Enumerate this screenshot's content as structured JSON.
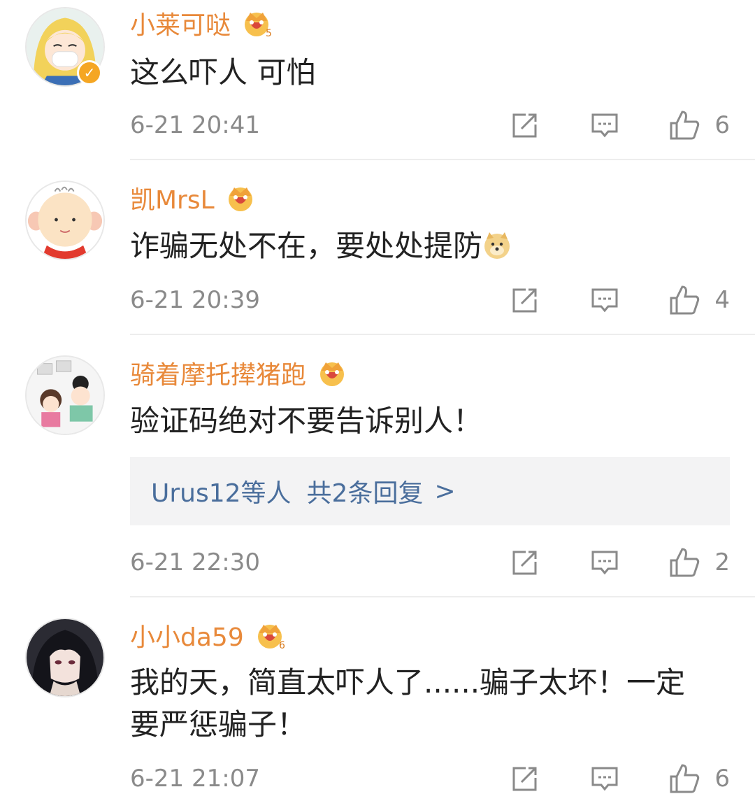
{
  "comments": [
    {
      "username": "小莱可哒",
      "verified_icon": "verified-check-icon",
      "vip_icon": "crown-icon",
      "vip_level": "5",
      "text": "这么吓人 可怕",
      "time": "6-21 20:41",
      "likes": "6"
    },
    {
      "username": "凯MrsL",
      "vip_icon": "crown-icon",
      "vip_level": "",
      "text": "诈骗无处不在，要处处提防",
      "emoji": "doge-emoji",
      "time": "6-21 20:39",
      "likes": "4"
    },
    {
      "username": "骑着摩托撵猪跑",
      "vip_icon": "crown-icon",
      "vip_level": "",
      "text": "验证码绝对不要告诉别人！",
      "reply_users": "Urus12等人",
      "reply_count": "共2条回复",
      "reply_arrow": ">",
      "time": "6-21 22:30",
      "likes": "2"
    },
    {
      "username": "小小da59",
      "vip_icon": "crown-icon",
      "vip_level": "6",
      "text_line1": "我的天，简直太吓人了......骗子太坏！一定",
      "text_line2": "要严惩骗子！",
      "time": "6-21 21:07",
      "likes": "6"
    }
  ],
  "colors": {
    "username": "#e8893a",
    "meta": "#8a8a8a",
    "reply_link": "#4a6e9c",
    "reply_bg": "#f3f3f4",
    "crown": "#f0a23a"
  },
  "icons": [
    "repost-icon",
    "comment-icon",
    "like-icon"
  ]
}
